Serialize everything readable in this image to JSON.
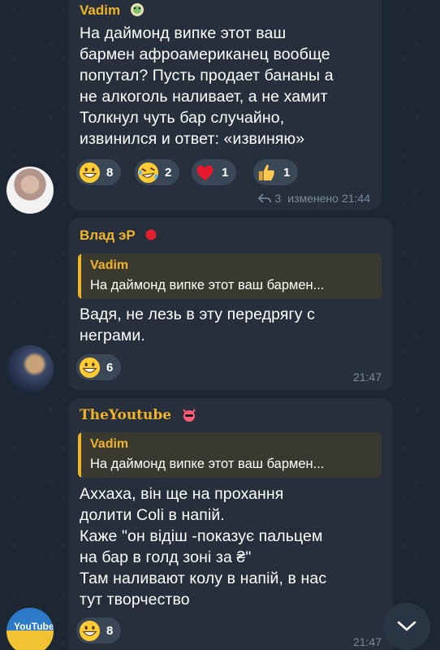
{
  "messages": [
    {
      "sender": "Vadim",
      "sender_color": "#f0b429",
      "text": "На даймонд випке этот ваш\nбармен афроамериканец вообще\nпопутал? Пусть продает бананы а\nне алкоголь наливает, а не хамит\nТолкнул чуть бар случайно,\nизвинился и ответ: «извиняю»",
      "reactions": [
        {
          "icon": "grinning-face-icon",
          "count": "8"
        },
        {
          "icon": "rofl-face-icon",
          "count": "2"
        },
        {
          "icon": "red-heart-icon",
          "count": "1"
        },
        {
          "icon": "thumbs-up-icon",
          "count": "1"
        }
      ],
      "replies": "3",
      "edited": "изменено",
      "time": "21:44"
    },
    {
      "sender": "Влад эР",
      "sender_color": "#f0b429",
      "reply_to": {
        "name": "Vadim",
        "text": "На даймонд випке этот ваш бармен..."
      },
      "text": "Вадя, не лезь в эту передрягу с\nнеграми.",
      "reactions": [
        {
          "icon": "grinning-face-icon",
          "count": "6"
        }
      ],
      "time": "21:47"
    },
    {
      "sender": "TheYoutube",
      "sender_color": "#f0b429",
      "reply_to": {
        "name": "Vadim",
        "text": "На даймонд випке этот ваш бармен..."
      },
      "text": "Аххаха, він ще на прохання\nдолити Coli в напій.\nКаже \"он відіш -показує пальцем\nна бар в голд зоні за ₴\"\nТам наливают колу в напій, в нас\nтут творчество",
      "reactions": [
        {
          "icon": "grinning-face-icon",
          "count": "8"
        }
      ],
      "time": "21:47"
    }
  ],
  "avatars": {
    "third_label": "YouTube"
  },
  "colors": {
    "bubble": "#262f3b",
    "accent": "#f0b429",
    "meta": "#7a8b9b",
    "reaction_bg": "#3a4756"
  }
}
